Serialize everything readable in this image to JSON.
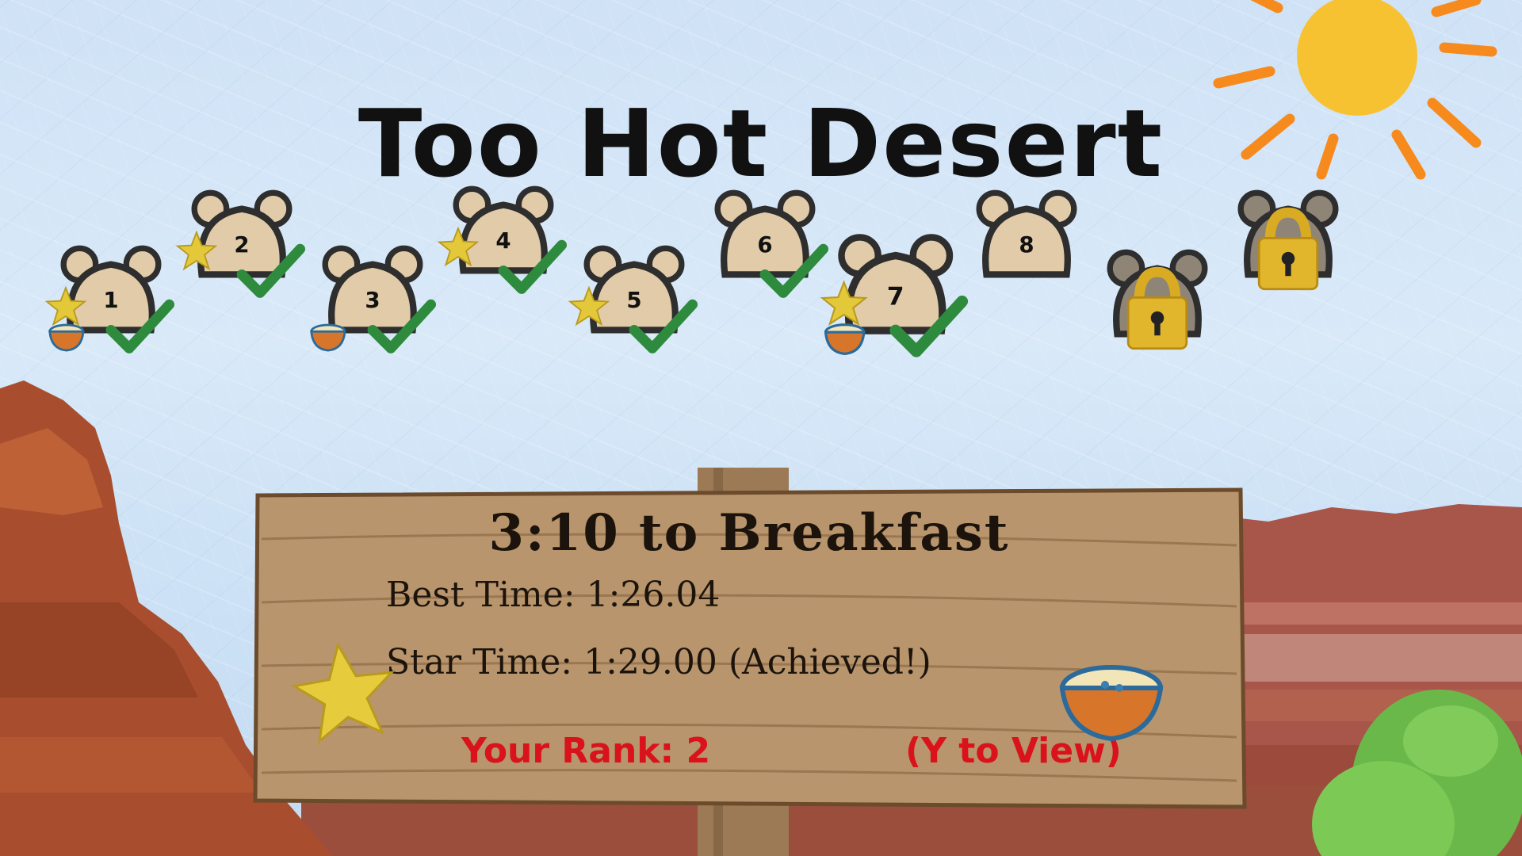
{
  "world_title": "Too Hot Desert",
  "levels": [
    {
      "number": "1",
      "star": true,
      "bowl": true,
      "completed": true
    },
    {
      "number": "2",
      "star": true,
      "bowl": false,
      "completed": true
    },
    {
      "number": "3",
      "star": false,
      "bowl": true,
      "completed": true
    },
    {
      "number": "4",
      "star": true,
      "bowl": false,
      "completed": true
    },
    {
      "number": "5",
      "star": true,
      "bowl": false,
      "completed": true
    },
    {
      "number": "6",
      "star": false,
      "bowl": false,
      "completed": true
    },
    {
      "number": "7",
      "star": true,
      "bowl": true,
      "completed": true,
      "selected": true
    },
    {
      "number": "8",
      "star": false,
      "bowl": false,
      "completed": false
    },
    {
      "number": "",
      "locked": true
    },
    {
      "number": "",
      "locked": true
    }
  ],
  "sign": {
    "level_name": "3:10 to Breakfast",
    "best_time": "Best Time: 1:26.04",
    "star_time": "Star Time: 1:29.00 (Achieved!)",
    "rank": "Your Rank: 2",
    "view_hint": "(Y to View)"
  },
  "colors": {
    "title": "#111111",
    "rank_text": "#d9121b",
    "check": "#2e8b3e",
    "star": "#e3c93a",
    "bear": "#e2cba8",
    "bear_outline": "#2e2e2e",
    "lock": "#e2b62c",
    "sky": "#cfe2f6"
  },
  "icons": [
    "sun-icon",
    "bear-level-icon",
    "checkmark-icon",
    "star-icon",
    "porridge-bowl-icon",
    "padlock-icon",
    "cactus-icon"
  ]
}
